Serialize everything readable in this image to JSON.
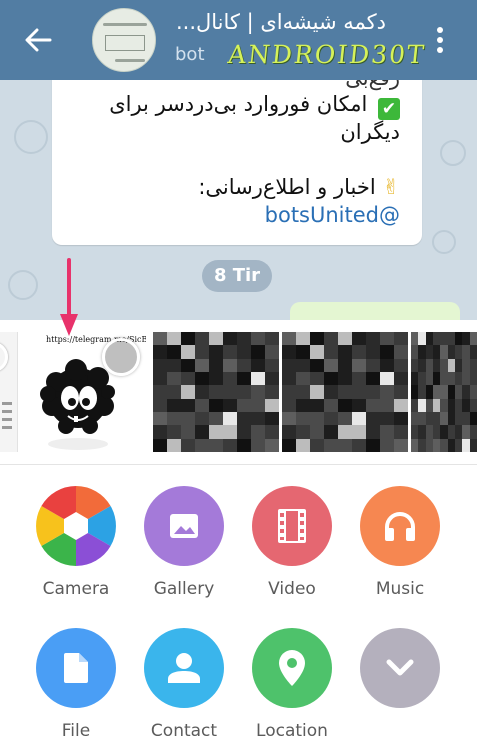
{
  "header": {
    "title": "دکمه شیشه‌ای | کانال...",
    "subtitle": "bot",
    "watermark": "ANDROID30T",
    "colors": {
      "bar": "#527da3"
    }
  },
  "chat": {
    "message_lines": [
      "رفع‌بی",
      "امکان فوروارد بی‌دردسر برای",
      "دیگران",
      "اخبار و اطلاع‌رسانی:",
      "botsUnited@"
    ],
    "check_emoji": "✔",
    "victory_emoji": "✌",
    "date_pill": "8 Tir"
  },
  "recent": {
    "sticker_url": "https://telegram.me/SicBot"
  },
  "attach_menu": [
    {
      "label": "Camera",
      "icon": "camera-aperture-icon",
      "color": "multicolor"
    },
    {
      "label": "Gallery",
      "icon": "image-icon",
      "color": "#a47ad9"
    },
    {
      "label": "Video",
      "icon": "film-icon",
      "color": "#e56771"
    },
    {
      "label": "Music",
      "icon": "headphones-icon",
      "color": "#f68751"
    },
    {
      "label": "File",
      "icon": "file-icon",
      "color": "#4a9ef5"
    },
    {
      "label": "Contact",
      "icon": "person-icon",
      "color": "#3ab5ec"
    },
    {
      "label": "Location",
      "icon": "location-pin-icon",
      "color": "#4ec26b"
    },
    {
      "label": "",
      "icon": "chevron-down-icon",
      "color": "#b4b0bd"
    }
  ]
}
